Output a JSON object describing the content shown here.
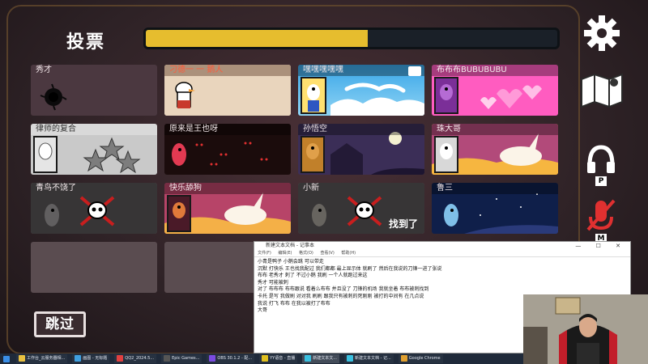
{
  "game": {
    "vote_title": "投票",
    "vote_progress": 0.54,
    "skip_label": "跳过",
    "found_label": "找到了",
    "players": [
      {
        "name": "秀才",
        "state": "dead-hole"
      },
      {
        "name": "刁德一 一 鹅人",
        "state": "alive"
      },
      {
        "name": "嘿嘿嘿嘿嘿",
        "state": "alive"
      },
      {
        "name": "布布布BUBUBUBU",
        "state": "alive"
      },
      {
        "name": "律师的复合",
        "state": "alive"
      },
      {
        "name": "原来是王也呀",
        "state": "alive"
      },
      {
        "name": "孙悟空",
        "state": "alive"
      },
      {
        "name": "珠大哥",
        "state": "alive"
      },
      {
        "name": "青鸟不饶了",
        "state": "dead"
      },
      {
        "name": "快乐舔狗",
        "state": "alive"
      },
      {
        "name": "小新",
        "state": "dead-found"
      },
      {
        "name": "鲁三",
        "state": "alive"
      }
    ]
  },
  "side_icons": {
    "settings": "gear-icon",
    "map": "map-icon",
    "voice": "headphones-icon",
    "voice_key": "P",
    "mic": "mic-muted-icon",
    "mic_key": "M"
  },
  "notepad": {
    "title": "新建文本文档 - 记事本",
    "menu": [
      "文件(F)",
      "编辑(E)",
      "格式(O)",
      "查看(V)",
      "帮助(H)"
    ],
    "lines": [
      "小青是鸭子 小鹅会跳 可以带走",
      "沉默 打快乐 王也找我配过 我们都都 最上显示体 就刷了 然后在我说的刀锋一进了张说",
      "布布 老秀才 刺了 不过小鹅 我刷 一个人就跑过来这",
      "秀才 可能被刺",
      "对了 布布布 布布跟说 看着么布布 并且没了 刀锋的机场 我就坐着 布布被刺找到",
      "卡托 是写 我做刷 对对我 刷刷 跟我只有被刺的死刚刚 被打的中间有 在几点说",
      "我说 打飞 布布 在我以被打了布布",
      "大哥"
    ]
  },
  "taskbar": {
    "items": [
      "工作台_云服务器相...",
      "画图 - 无标题",
      "QQ2_2024.5...",
      "Epic Games...",
      "OBS 30.1.2 - 配...",
      "YY语音 - 直播",
      "新建文本文...",
      "新建文本文档 - 记...",
      "Google Chrome"
    ]
  },
  "colors": {
    "progress": "#e6bd2e",
    "highlight": "#f0c030"
  }
}
